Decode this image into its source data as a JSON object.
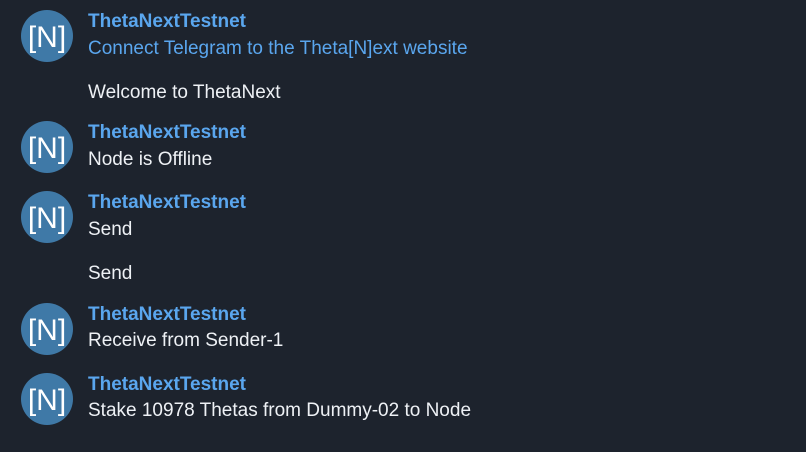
{
  "messages": [
    {
      "sender": "ThetaNextTestnet",
      "avatar_text": "[N]",
      "lines": [
        "Connect Telegram to the Theta[N]ext website",
        "Welcome to ThetaNext"
      ]
    },
    {
      "sender": "ThetaNextTestnet",
      "avatar_text": "[N]",
      "lines": [
        "Node is Offline"
      ]
    },
    {
      "sender": "ThetaNextTestnet",
      "avatar_text": "[N]",
      "lines": [
        "Send",
        "Send"
      ]
    },
    {
      "sender": "ThetaNextTestnet",
      "avatar_text": "[N]",
      "lines": [
        "Receive from Sender-1"
      ]
    },
    {
      "sender": "ThetaNextTestnet",
      "avatar_text": "[N]",
      "lines": [
        "Stake 10978 Thetas from Dummy-02 to Node"
      ]
    }
  ],
  "colors": {
    "background": "#1d232d",
    "sender_name": "#5aa6ee",
    "link": "#5aa6ee",
    "message_text": "#eef1f5",
    "avatar_background": "#3f79a7"
  },
  "icons": {
    "avatar": "theta-next-logo-icon"
  }
}
